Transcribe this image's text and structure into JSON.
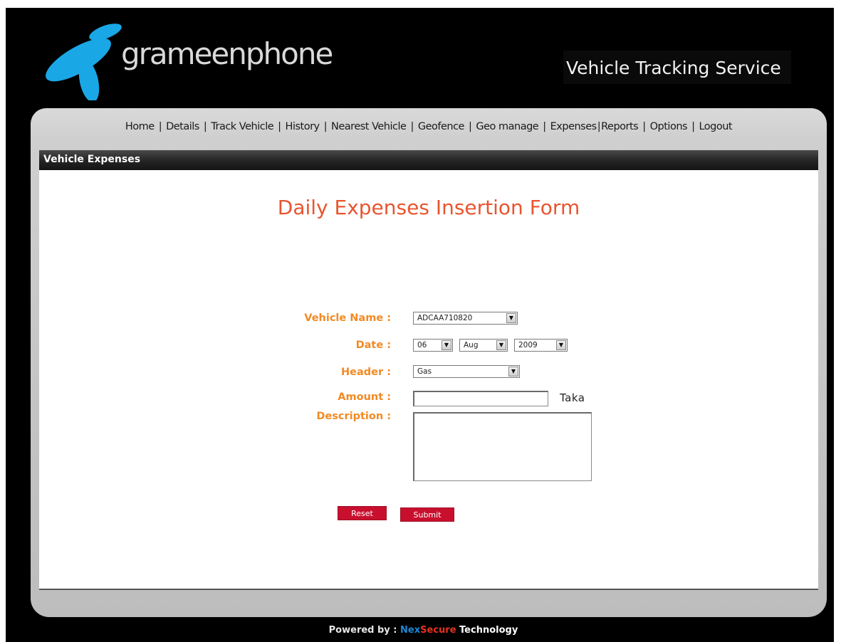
{
  "header": {
    "brand_name": "grameenphone",
    "service_title": "Vehicle Tracking Service"
  },
  "nav": {
    "items": [
      "Home",
      "Details",
      "Track Vehicle",
      "History",
      "Nearest Vehicle",
      "Geofence",
      "Geo manage",
      "Expenses",
      "Reports",
      "Options",
      "Logout"
    ],
    "separator": "|"
  },
  "section": {
    "title": "Vehicle Expenses"
  },
  "form": {
    "title": "Daily Expenses Insertion Form",
    "vehicle_label": "Vehicle Name :",
    "vehicle_value": "ADCAA710820",
    "date_label": "Date :",
    "date_day": "06",
    "date_month": "Aug",
    "date_year": "2009",
    "header_label": "Header :",
    "header_value": "Gas",
    "amount_label": "Amount :",
    "amount_value": "",
    "amount_unit": "Taka",
    "description_label": "Description :",
    "description_value": "",
    "reset_label": "Reset",
    "submit_label": "Submit"
  },
  "footer": {
    "prefix": "Powered by : ",
    "brand_part1": "Nex",
    "brand_part2": "Secure",
    "brand_part3": " Technology"
  },
  "colors": {
    "accent_orange": "#f28a24",
    "title_red": "#e8552f",
    "button_red": "#c8102e",
    "logo_blue": "#1aa7e6"
  },
  "icons": {
    "logo": "grameenphone-telenor-icon",
    "select_arrow": "chevron-down-icon"
  }
}
